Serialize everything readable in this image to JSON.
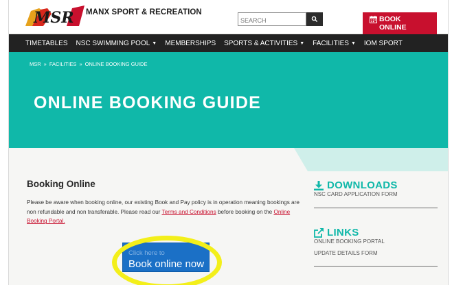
{
  "header": {
    "logo_text": "MSR",
    "brand": "MANX SPORT & RECREATION",
    "search_placeholder": "SEARCH",
    "book_label_line1": "BOOK",
    "book_label_line2": "ONLINE"
  },
  "nav": {
    "items": [
      {
        "label": "TIMETABLES",
        "dropdown": false
      },
      {
        "label": "NSC SWIMMING POOL",
        "dropdown": true
      },
      {
        "label": "MEMBERSHIPS",
        "dropdown": false
      },
      {
        "label": "SPORTS & ACTIVITIES",
        "dropdown": true
      },
      {
        "label": "FACILITIES",
        "dropdown": true
      },
      {
        "label": "IOM SPORT",
        "dropdown": false
      }
    ]
  },
  "breadcrumb": {
    "items": [
      "MSR",
      "FACILITIES",
      "ONLINE BOOKING GUIDE"
    ],
    "separator": "»"
  },
  "hero": {
    "title": "ONLINE BOOKING GUIDE"
  },
  "main": {
    "title": "Booking Online",
    "text1": "Please be aware when booking online, our existing Book and Pay policy is in operation meaning bookings are non refundable and non transferable. Please read our ",
    "terms_link": "Terms and Conditions",
    "text2": " before booking on the ",
    "portal_link": "Online Booking Portal.",
    "cta_small": "Click here to",
    "cta_big": "Book online now"
  },
  "sidebar": {
    "downloads_title": "DOWNLOADS",
    "downloads_items": [
      "NSC CARD APPLICATION FORM"
    ],
    "links_title": "LINKS",
    "links_items": [
      "ONLINE BOOKING PORTAL",
      "UPDATE DETAILS FORM"
    ]
  },
  "colors": {
    "teal": "#10b8a9",
    "red": "#c8102e",
    "nav_bg": "#222222",
    "cta_blue": "#1b70c6",
    "highlight_yellow": "#f3ef1a"
  },
  "icons": [
    "search-icon",
    "calendar-icon",
    "download-icon",
    "external-link-icon",
    "chevron-down-icon"
  ]
}
